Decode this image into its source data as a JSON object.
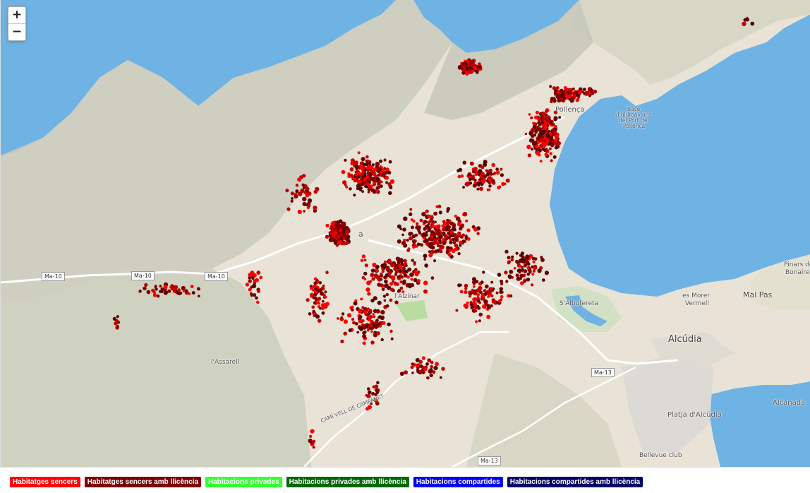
{
  "zoom": {
    "in_label": "+",
    "out_label": "−"
  },
  "places": {
    "alcudia": "Alcúdia",
    "mal_pas": "Mal Pas",
    "alcanada": "Alcanada",
    "es_morer_vermell_1": "es Morer",
    "es_morer_vermell_2": "Vermell",
    "salbufereta": "S'Albufereta",
    "lalzinar": "l'Alzinar",
    "assarell": "l'Assarell",
    "pinars_1": "Pinars de",
    "pinars_2": "Bonaire",
    "platja_alcudia": "Platja d'Alcúdia",
    "bellevue": "Bellevue club",
    "base_1": "Base",
    "base_2": "d'hidroavions",
    "base_3": "del Port de",
    "base_4": "Pollença",
    "cami_vell": "CAMÍ VELL DE CAMPANET",
    "pollenca_town": "a",
    "port_pollenca": "Pollença"
  },
  "roads": {
    "ma10_a": "Ma-10",
    "ma10_b": "Ma-10",
    "ma10_c": "Ma-10",
    "ma13_a": "Ma-13",
    "ma13_b": "Ma-13"
  },
  "legend": [
    {
      "label": "Habitatges sencers",
      "color": "#ff0000"
    },
    {
      "label": "Habitatges sencers amb llicència",
      "color": "#7a0000"
    },
    {
      "label": "Habitacions privades",
      "color": "#33ff33"
    },
    {
      "label": "Habitacions privades amb llicència",
      "color": "#006600"
    },
    {
      "label": "Habitacions compartides",
      "color": "#0000ee"
    },
    {
      "label": "Habitacions compartides amb llicència",
      "color": "#000066"
    }
  ],
  "colors": {
    "sea": "#6fb2e4",
    "land": "#e8e3d6",
    "mountain": "#c9cbbd",
    "listing_red": "#ff0000",
    "listing_dark": "#7a0000"
  }
}
